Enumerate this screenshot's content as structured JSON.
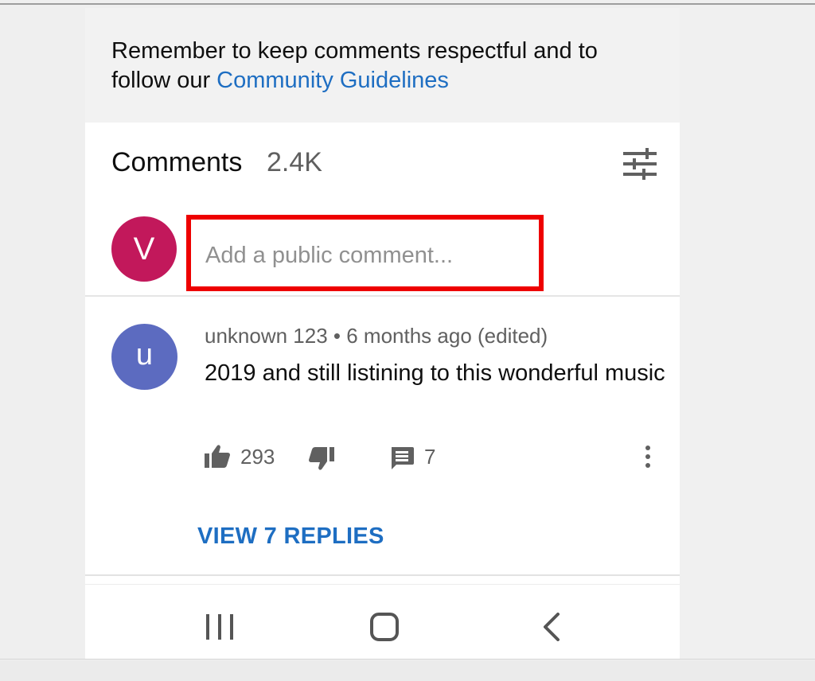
{
  "guidelines": {
    "text": "Remember to keep comments respectful and to follow our ",
    "link": "Community Guidelines"
  },
  "comments_header": {
    "title": "Comments",
    "count": "2.4K",
    "sort_icon": "sort-filter-icon"
  },
  "compose": {
    "avatar_letter": "V",
    "avatar_color": "#c2185b",
    "placeholder": "Add a public comment...",
    "highlight_color": "#ee0000"
  },
  "comment": {
    "avatar_letter": "u",
    "avatar_color": "#5c6bc0",
    "meta": "unknown 123 • 6 months ago (edited)",
    "body": "2019 and still listining to this wonderful music",
    "likes": "293",
    "replies_count": "7",
    "view_replies": "VIEW 7 REPLIES"
  },
  "nav": {
    "recents_icon": "recents-icon",
    "home_icon": "home-icon",
    "back_icon": "back-icon"
  },
  "colors": {
    "link": "#1e6ec2",
    "secondary_text": "#606060"
  }
}
